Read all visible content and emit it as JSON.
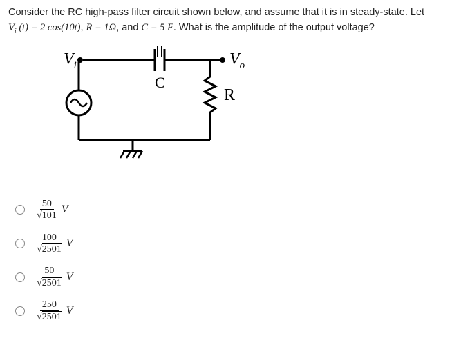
{
  "question": {
    "line1_part1": "Consider the RC high-pass filter circuit shown below, and assume that it is in steady-state. Let",
    "line2_eq1": "V",
    "line2_sub1": "i",
    "line2_eq2": " (t) = 2 cos(10t)",
    "line2_sep1": ", ",
    "line2_eq3": "R = 1Ω",
    "line2_sep2": ", and ",
    "line2_eq4": "C = 5 F",
    "line2_part2": ". What is the amplitude of the output voltage?"
  },
  "circuit": {
    "vi": "V",
    "vi_sub": "i",
    "vo": "V",
    "vo_sub": "o",
    "c": "C",
    "r": "R"
  },
  "options": [
    {
      "num": "50",
      "den": "101",
      "unit": "V"
    },
    {
      "num": "100",
      "den": "2501",
      "unit": "V"
    },
    {
      "num": "50",
      "den": "2501",
      "unit": "V"
    },
    {
      "num": "250",
      "den": "2501",
      "unit": "V"
    }
  ]
}
